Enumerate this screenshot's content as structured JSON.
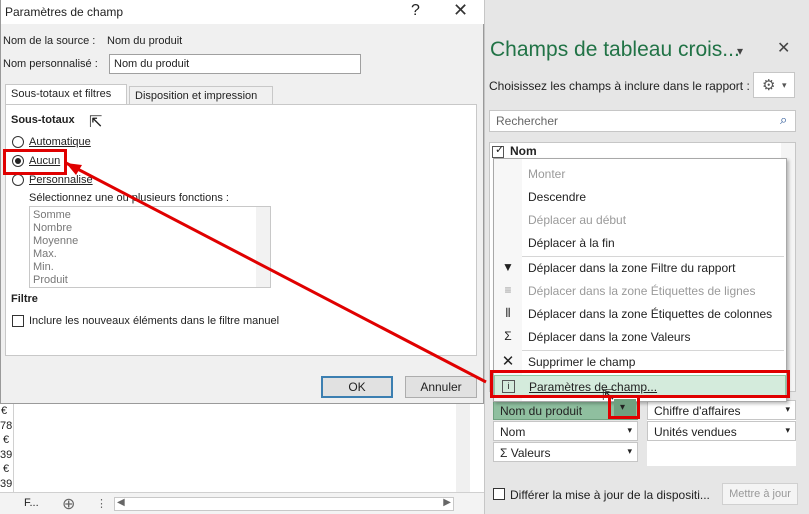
{
  "dialog": {
    "title": "Paramètres de champ",
    "help": "?",
    "close": "✕",
    "source_label": "Nom de la source :",
    "source_value": "Nom du produit",
    "custom_label": "Nom personnalisé :",
    "custom_value": "Nom du produit",
    "tabs": [
      "Sous-totaux et filtres",
      "Disposition et impression"
    ],
    "subtotals_heading": "Sous-totaux",
    "radios": [
      "Automatique",
      "Aucun",
      "Personnalisé"
    ],
    "functions_label": "Sélectionnez une ou plusieurs fonctions :",
    "functions": [
      "Somme",
      "Nombre",
      "Moyenne",
      "Max.",
      "Min.",
      "Produit"
    ],
    "filter_heading": "Filtre",
    "filter_checkbox": "Inclure les nouveaux éléments dans le filtre manuel",
    "ok": "OK",
    "cancel": "Annuler"
  },
  "sheet": {
    "cells": [
      "€",
      "78",
      "€",
      "39",
      "€",
      "39"
    ],
    "sheet_tab": "F...",
    "add": "⊕"
  },
  "pane": {
    "title": "Champs de tableau crois...",
    "choose_label": "Choisissez les champs à inclure dans le rapport :",
    "search_placeholder": "Rechercher",
    "field_name": "Nom",
    "rows_chip": "Nom du produit",
    "columns_chip_1": "Chiffre d'affaires",
    "columns_chip_2": "Unités vendues",
    "rows_chip_2": "Nom",
    "values_chip": "Σ Valeurs",
    "defer_label": "Différer la mise à jour de la dispositi...",
    "update_button": "Mettre à jour"
  },
  "menu": {
    "items": [
      {
        "label": "Monter",
        "icon": "",
        "disabled": true
      },
      {
        "label": "Descendre",
        "icon": "",
        "disabled": false
      },
      {
        "label": "Déplacer au début",
        "icon": "",
        "disabled": true
      },
      {
        "label": "Déplacer à la fin",
        "icon": "",
        "disabled": false
      },
      {
        "label": "Déplacer dans la zone Filtre du rapport",
        "icon": "filter-icon",
        "disabled": false
      },
      {
        "label": "Déplacer dans la zone Étiquettes de lignes",
        "icon": "rows-icon",
        "disabled": true
      },
      {
        "label": "Déplacer dans la zone Étiquettes de colonnes",
        "icon": "columns-icon",
        "disabled": false
      },
      {
        "label": "Déplacer dans la zone Valeurs",
        "icon": "sigma-icon",
        "disabled": false
      },
      {
        "label": "Supprimer le champ",
        "icon": "remove-icon",
        "disabled": false
      },
      {
        "label": "Paramètres de champ...",
        "icon": "field-settings-icon",
        "disabled": false
      }
    ]
  },
  "colors": {
    "accent": "#217346",
    "highlight": "#e00000",
    "menu_hover": "#d4ebdc"
  }
}
